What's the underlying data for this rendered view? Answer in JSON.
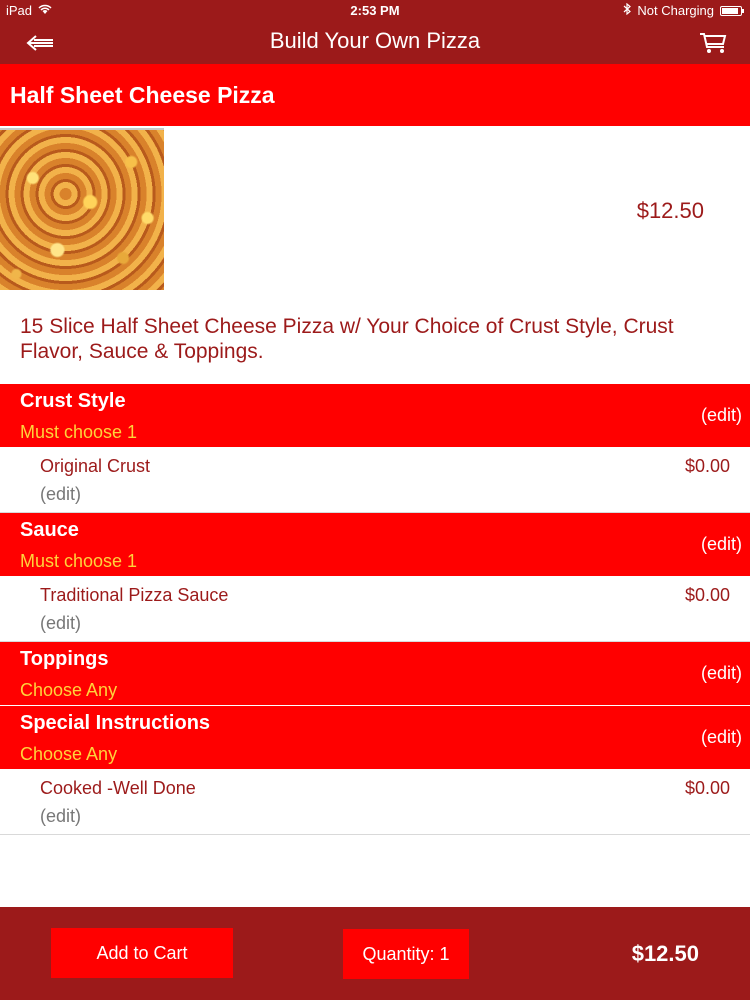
{
  "status_bar": {
    "device": "iPad",
    "time": "2:53 PM",
    "charging": "Not Charging",
    "battery_level": 0.9,
    "icons": [
      "wifi-icon",
      "bluetooth-icon",
      "battery-icon"
    ]
  },
  "nav": {
    "title": "Build Your Own Pizza",
    "back_icon": "back-arrow-icon",
    "cart_icon": "cart-icon"
  },
  "item": {
    "name": "Half Sheet Cheese Pizza",
    "price": "$12.50",
    "description": "15 Slice Half Sheet Cheese Pizza w/ Your Choice of Crust Style, Crust Flavor, Sauce & Toppings."
  },
  "sections": [
    {
      "title": "Crust Style",
      "subtitle": "Must choose 1",
      "edit_label": "(edit)",
      "options": [
        {
          "name": "Original Crust",
          "price": "$0.00",
          "edit_label": "(edit)"
        }
      ]
    },
    {
      "title": "Sauce",
      "subtitle": "Must choose 1",
      "edit_label": "(edit)",
      "options": [
        {
          "name": "Traditional Pizza Sauce",
          "price": "$0.00",
          "edit_label": "(edit)"
        }
      ]
    },
    {
      "title": "Toppings",
      "subtitle": "Choose Any",
      "edit_label": "(edit)",
      "options": []
    },
    {
      "title": "Special Instructions",
      "subtitle": "Choose Any",
      "edit_label": "(edit)",
      "options": [
        {
          "name": "Cooked -Well Done",
          "price": "$0.00",
          "edit_label": "(edit)"
        }
      ]
    }
  ],
  "footer": {
    "add_to_cart_label": "Add to Cart",
    "quantity_label": "Quantity: 1",
    "total": "$12.50"
  },
  "colors": {
    "dark_red": "#9c1a1a",
    "bright_red": "#ff0000",
    "subtitle_yellow": "#ffd33b",
    "edit_gray": "#777777"
  }
}
